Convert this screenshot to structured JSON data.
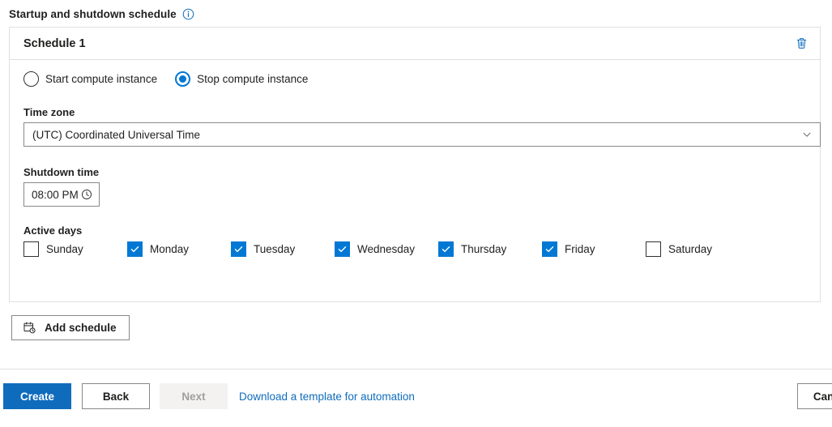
{
  "section": {
    "title": "Startup and shutdown schedule",
    "info_icon": "info-circle-icon"
  },
  "schedule_card": {
    "header_title": "Schedule 1",
    "delete_icon": "trash-icon",
    "action_radio": {
      "options": [
        {
          "label": "Start compute instance",
          "selected": false
        },
        {
          "label": "Stop compute instance",
          "selected": true
        }
      ]
    },
    "time_zone": {
      "label": "Time zone",
      "value": "(UTC) Coordinated Universal Time",
      "chevron_icon": "chevron-down-icon"
    },
    "shutdown_time": {
      "label": "Shutdown time",
      "value": "08:00 PM",
      "clock_icon": "clock-icon"
    },
    "active_days": {
      "label": "Active days",
      "days": [
        {
          "label": "Sunday",
          "checked": false
        },
        {
          "label": "Monday",
          "checked": true
        },
        {
          "label": "Tuesday",
          "checked": true
        },
        {
          "label": "Wednesday",
          "checked": true
        },
        {
          "label": "Thursday",
          "checked": true
        },
        {
          "label": "Friday",
          "checked": true
        },
        {
          "label": "Saturday",
          "checked": false
        }
      ]
    }
  },
  "add_schedule": {
    "label": "Add schedule",
    "icon": "calendar-clock-icon"
  },
  "footer": {
    "create_label": "Create",
    "back_label": "Back",
    "next_label": "Next",
    "template_link": "Download a template for automation",
    "cancel_label": "Cancel"
  },
  "colors": {
    "accent": "#0078d4",
    "primary_button": "#0f6cbd",
    "link": "#0f6cbd",
    "border": "#8a8886",
    "card_border": "#e1dfdd",
    "disabled_bg": "#f3f2f1",
    "disabled_text": "#a19f9d",
    "text": "#201f1e"
  }
}
